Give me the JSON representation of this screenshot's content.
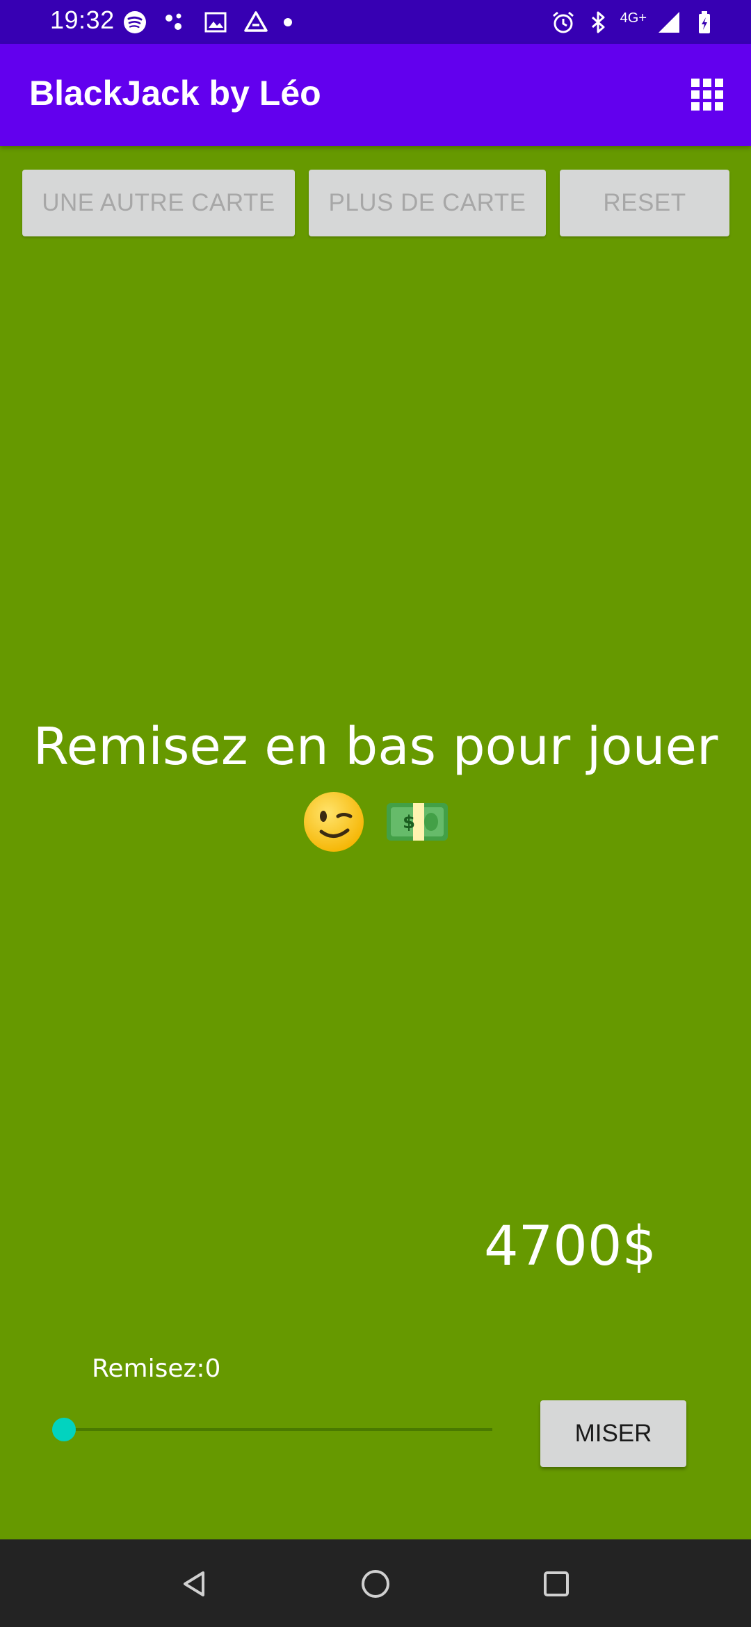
{
  "status_bar": {
    "time": "19:32",
    "left_icons": [
      "spotify-icon",
      "dots-icon",
      "image-icon",
      "drive-icon",
      "dot-icon"
    ],
    "network_label": "4G+",
    "right_icons": [
      "alarm-icon",
      "bluetooth-icon",
      "signal-icon",
      "battery-icon"
    ]
  },
  "app_bar": {
    "title": "BlackJack by Léo",
    "menu_icon": "grid-icon"
  },
  "actions": {
    "hit_label": "UNE AUTRE CARTE",
    "stand_label": "PLUS DE CARTE",
    "reset_label": "RESET"
  },
  "main": {
    "message": "Remisez en bas pour jouer",
    "emojis": [
      "wink-emoji",
      "money-emoji"
    ]
  },
  "balance": {
    "amount": "4700$"
  },
  "bet": {
    "label": "Remisez:0",
    "slider_value": 0,
    "button_label": "MISER"
  },
  "colors": {
    "status_bar": "#3700b3",
    "app_bar": "#6200ee",
    "background": "#669900",
    "slider_thumb": "#02d3bf",
    "button_bg": "#d6d7d7",
    "nav_bar": "#232323"
  },
  "nav_bar": {
    "buttons": [
      "back-icon",
      "home-icon",
      "recents-icon"
    ]
  }
}
